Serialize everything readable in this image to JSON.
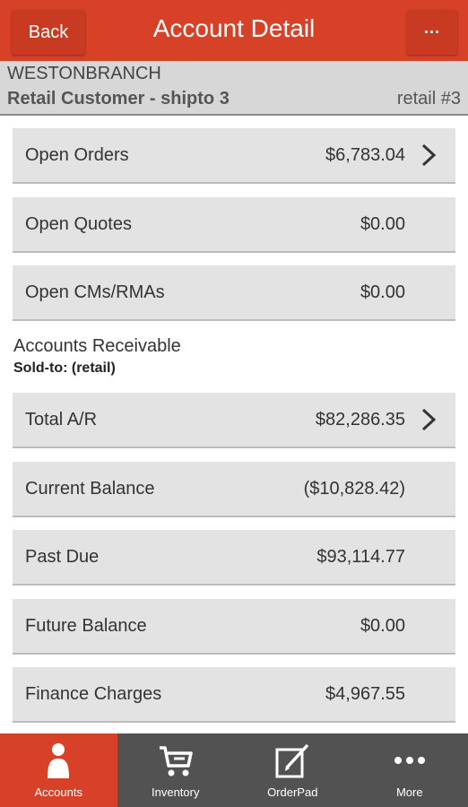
{
  "nav": {
    "back_label": "Back",
    "title": "Account Detail",
    "more_label": "···"
  },
  "account": {
    "branch": "WESTONBRANCH",
    "customer": "Retail Customer - shipto 3",
    "account_no": "retail #3"
  },
  "open_items": [
    {
      "label": "Open Orders",
      "value": "$6,783.04",
      "has_chevron": true
    },
    {
      "label": "Open Quotes",
      "value": "$0.00",
      "has_chevron": false
    },
    {
      "label": "Open CMs/RMAs",
      "value": "$0.00",
      "has_chevron": false
    }
  ],
  "ar_section": {
    "title": "Accounts Receivable",
    "subtitle": "Sold-to: (retail)"
  },
  "ar_items": [
    {
      "label": "Total A/R",
      "value": "$82,286.35",
      "has_chevron": true
    },
    {
      "label": "Current Balance",
      "value": "($10,828.42)",
      "has_chevron": false
    },
    {
      "label": "Past Due",
      "value": "$93,114.77",
      "has_chevron": false
    },
    {
      "label": "Future Balance",
      "value": "$0.00",
      "has_chevron": false
    },
    {
      "label": "Finance Charges",
      "value": "$4,967.55",
      "has_chevron": false
    }
  ],
  "tabs": [
    {
      "label": "Accounts",
      "icon": "person-icon",
      "active": true
    },
    {
      "label": "Inventory",
      "icon": "cart-icon",
      "active": false
    },
    {
      "label": "OrderPad",
      "icon": "edit-icon",
      "active": false
    },
    {
      "label": "More",
      "icon": "more-dots-icon",
      "active": false
    }
  ],
  "colors": {
    "brand": "#d64127",
    "tabbar": "#525252",
    "row_bg": "#e3e3e3"
  }
}
